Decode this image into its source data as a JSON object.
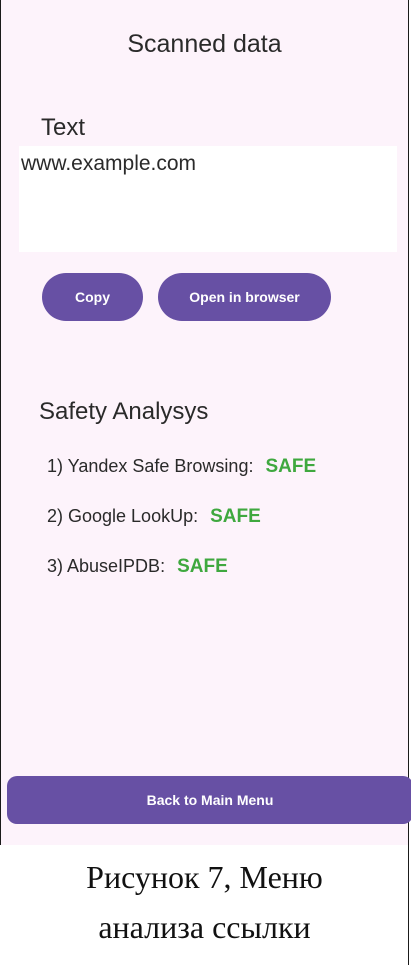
{
  "screen": {
    "title": "Scanned data",
    "text_label": "Text",
    "scanned_text": "www.example.com"
  },
  "actions": {
    "copy_label": "Copy",
    "open_label": "Open in browser",
    "back_label": "Back to Main Menu"
  },
  "safety": {
    "title": "Safety Analysys",
    "checks": [
      {
        "label": "1) Yandex Safe Browsing:",
        "status": "SAFE"
      },
      {
        "label": "2) Google LookUp:",
        "status": "SAFE"
      },
      {
        "label": "3) AbuseIPDB:",
        "status": "SAFE"
      }
    ]
  },
  "caption": {
    "line1": "Рисунок 7, Меню",
    "line2": "анализа ссылки"
  },
  "colors": {
    "accent": "#6750a4",
    "safe": "#3fa83f",
    "background": "#fdf3fb"
  }
}
